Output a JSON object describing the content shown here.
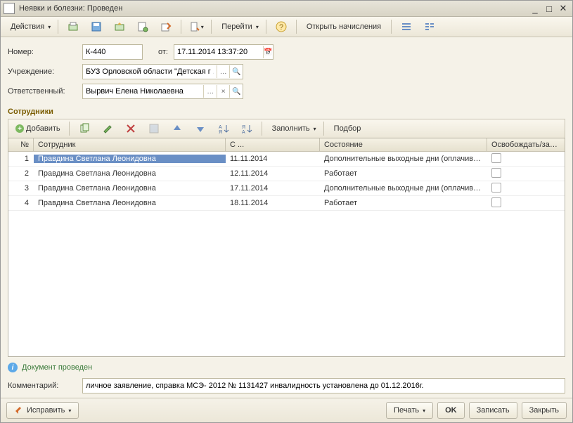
{
  "title": "Неявки и болезни: Проведен",
  "toolbar": {
    "actions": "Действия",
    "goto": "Перейти",
    "open_calc": "Открыть начисления"
  },
  "form": {
    "num_label": "Номер:",
    "num": "К-440",
    "from_label": "от:",
    "date": "17.11.2014 13:37:20",
    "org_label": "Учреждение:",
    "org": "БУЗ Орловской области \"Детская г ...",
    "resp_label": "Ответственный:",
    "resp": "Вырвич Елена Николаевна"
  },
  "section": "Сотрудники",
  "gtb": {
    "add": "Добавить",
    "fill": "Заполнить",
    "select": "Подбор"
  },
  "cols": {
    "n": "№",
    "emp": "Сотрудник",
    "date": "С ...",
    "state": "Состояние",
    "rel": "Освобождать/зани..."
  },
  "rows": [
    {
      "n": "1",
      "emp": "Правдина Светлана Леонидовна",
      "date": "11.11.2014",
      "state": "Дополнительные выходные дни (оплачивае...",
      "chk": false
    },
    {
      "n": "2",
      "emp": "Правдина Светлана Леонидовна",
      "date": "12.11.2014",
      "state": "Работает",
      "chk": false
    },
    {
      "n": "3",
      "emp": "Правдина Светлана Леонидовна",
      "date": "17.11.2014",
      "state": "Дополнительные выходные дни (оплачивае...",
      "chk": false
    },
    {
      "n": "4",
      "emp": "Правдина Светлана Леонидовна",
      "date": "18.11.2014",
      "state": "Работает",
      "chk": false
    }
  ],
  "status": "Документ проведен",
  "comment_label": "Комментарий:",
  "comment": "личное заявление, справка МСЭ- 2012 № 1131427 инвалидность установлена до 01.12.2016г.",
  "footer": {
    "fix": "Исправить",
    "print": "Печать",
    "ok": "OK",
    "save": "Записать",
    "close": "Закрыть"
  }
}
